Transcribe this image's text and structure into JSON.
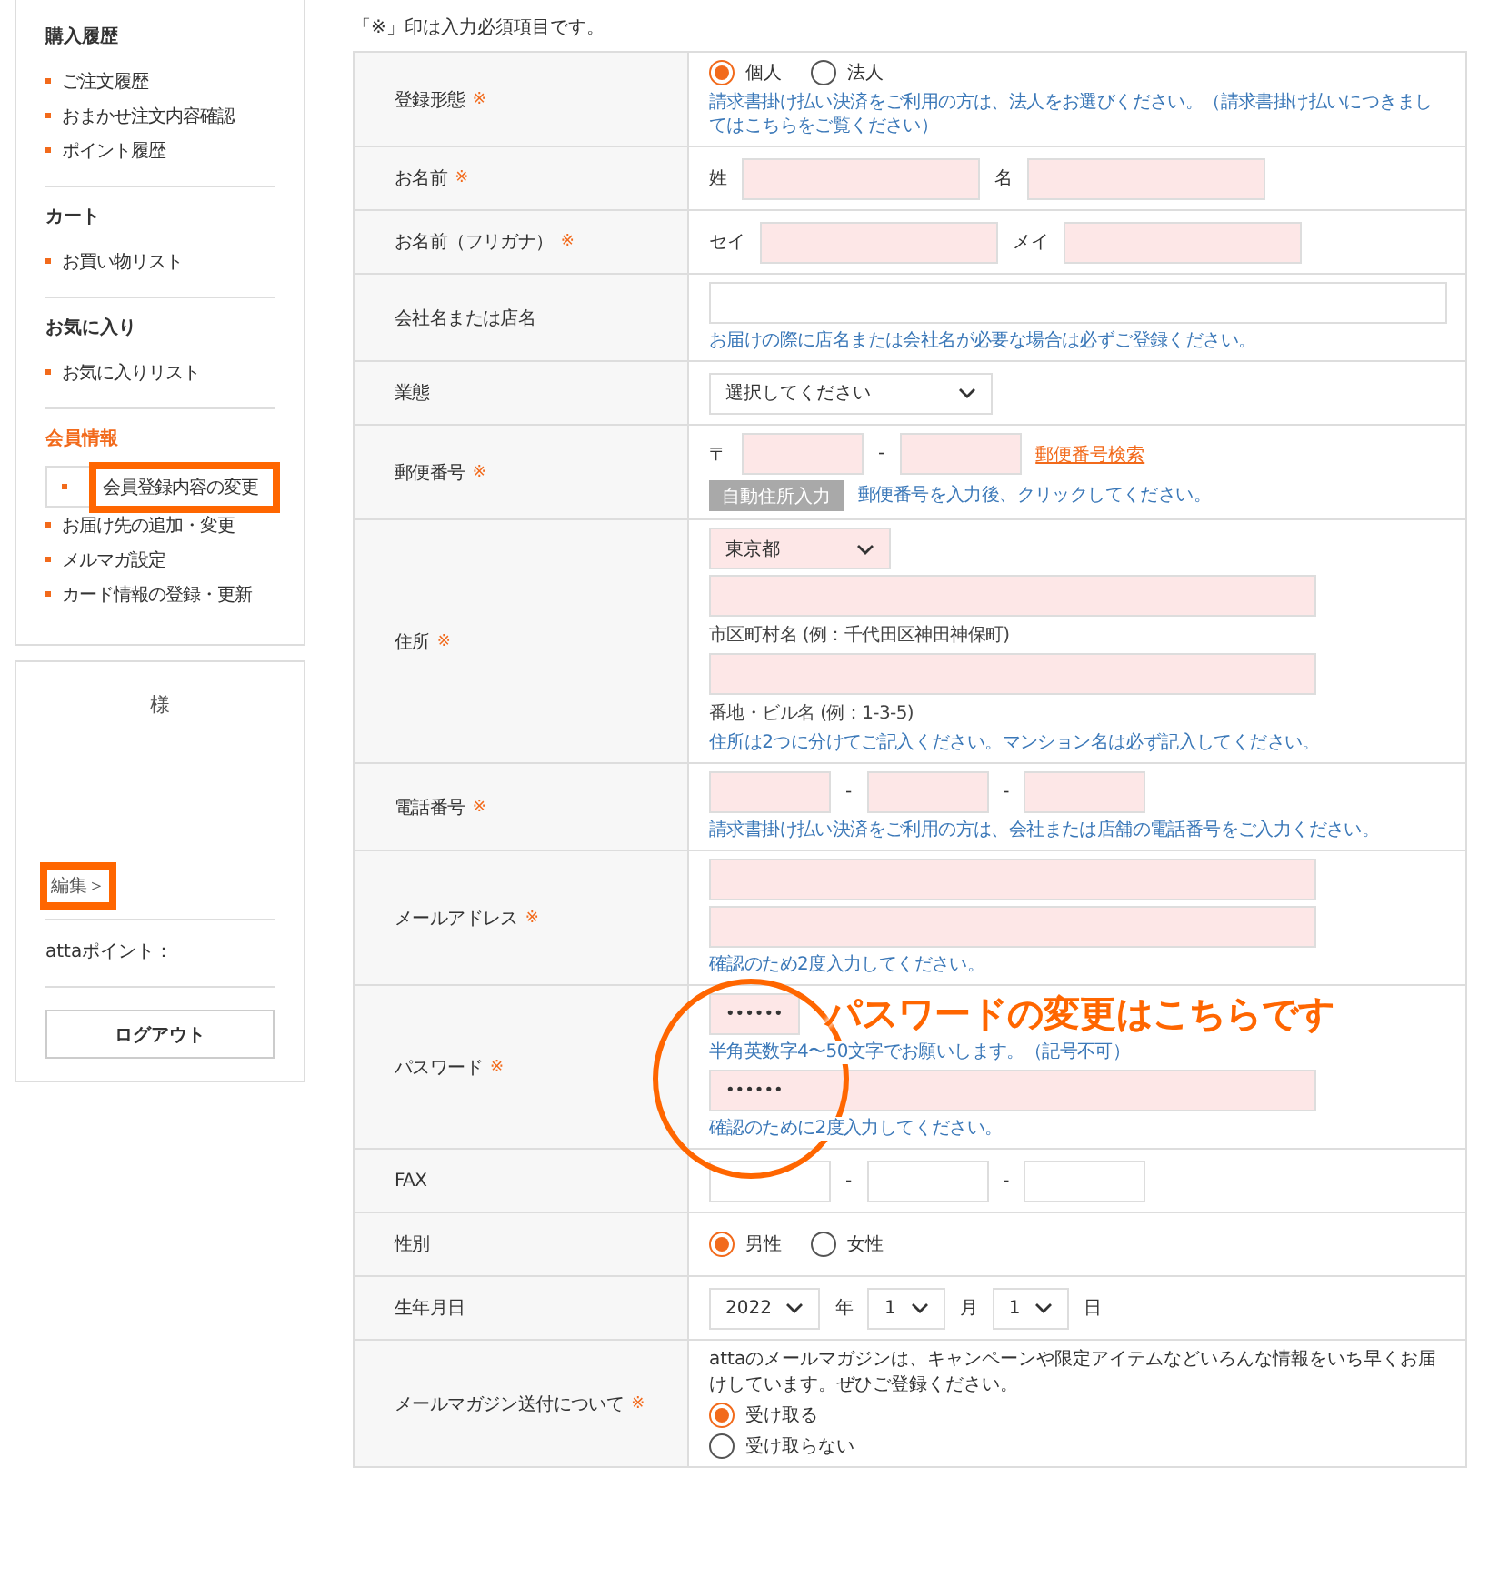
{
  "sidebar": {
    "sections": [
      {
        "title": "購入履歴",
        "active": false,
        "items": [
          {
            "label": "ご注文履歴",
            "selected": false
          },
          {
            "label": "おまかせ注文内容確認",
            "selected": false
          },
          {
            "label": "ポイント履歴",
            "selected": false
          }
        ]
      },
      {
        "title": "カート",
        "active": false,
        "items": [
          {
            "label": "お買い物リスト",
            "selected": false
          }
        ]
      },
      {
        "title": "お気に入り",
        "active": false,
        "items": [
          {
            "label": "お気に入りリスト",
            "selected": false
          }
        ]
      },
      {
        "title": "会員情報",
        "active": true,
        "items": [
          {
            "label": "会員登録内容の変更",
            "selected": true
          },
          {
            "label": "お届け先の追加・変更",
            "selected": false
          },
          {
            "label": "メルマガ設定",
            "selected": false
          },
          {
            "label": "カード情報の登録・更新",
            "selected": false
          }
        ]
      }
    ]
  },
  "member_card": {
    "honorific": "様",
    "edit_link": {
      "label": "編集＞",
      "highlighted": true
    },
    "points_label": "attaポイント：",
    "logout_button": "ログアウト"
  },
  "required_note": "「※」印は入力必須項目です。",
  "form": {
    "rows": [
      {
        "label": "登録形態",
        "mark": "※",
        "lines": [
          [
            {
              "kind": "radio",
              "label": "個人",
              "selected": true
            },
            {
              "kind": "radio",
              "label": "法人",
              "selected": false
            }
          ],
          [
            {
              "kind": "note",
              "text": "請求書掛け払い決済をご利用の方は、法人をお選びください。（請求書掛け払いにつきましてはこちらをご覧ください）"
            }
          ]
        ]
      },
      {
        "label": "お名前",
        "mark": "※",
        "lines": [
          [
            {
              "kind": "label",
              "text": "姓"
            },
            {
              "kind": "input",
              "required": true
            },
            {
              "kind": "label",
              "text": "名"
            },
            {
              "kind": "input",
              "required": true
            }
          ]
        ]
      },
      {
        "label": "お名前（フリガナ）",
        "mark": "※",
        "lines": [
          [
            {
              "kind": "label",
              "text": "セイ"
            },
            {
              "kind": "input",
              "required": true
            },
            {
              "kind": "label",
              "text": "メイ"
            },
            {
              "kind": "input",
              "required": true
            }
          ]
        ]
      },
      {
        "label": "会社名または店名",
        "lines": [
          [
            {
              "kind": "input",
              "required": false
            }
          ],
          [
            {
              "kind": "note",
              "text": "お届けの際に店名または会社名が必要な場合は必ずご登録ください。"
            }
          ]
        ]
      },
      {
        "label": "業態",
        "lines": [
          [
            {
              "kind": "select",
              "required": false,
              "value": "選択してください"
            }
          ]
        ]
      },
      {
        "label": "郵便番号",
        "mark": "※",
        "lines": [
          [
            {
              "kind": "label",
              "text": "〒"
            },
            {
              "kind": "input",
              "required": true
            },
            {
              "kind": "label",
              "text": "-"
            },
            {
              "kind": "input",
              "required": true
            },
            {
              "kind": "link",
              "text": "郵便番号検索"
            }
          ],
          [
            {
              "kind": "button",
              "text": "自動住所入力",
              "disabled": true
            },
            {
              "kind": "note",
              "text": "郵便番号を入力後、クリックしてください。"
            }
          ]
        ]
      },
      {
        "label": "住所",
        "mark": "※",
        "lines": [
          [
            {
              "kind": "select",
              "required": true,
              "value": "東京都"
            }
          ],
          [
            {
              "kind": "input",
              "required": true
            }
          ],
          [
            {
              "kind": "caption",
              "text": "市区町村名 (例：千代田区神田神保町)"
            }
          ],
          [
            {
              "kind": "input",
              "required": true
            }
          ],
          [
            {
              "kind": "caption",
              "text": "番地・ビル名 (例：1-3-5)"
            }
          ],
          [
            {
              "kind": "note",
              "text": "住所は2つに分けてご記入ください。マンション名は必ず記入してください。"
            }
          ]
        ]
      },
      {
        "label": "電話番号",
        "mark": "※",
        "lines": [
          [
            {
              "kind": "input",
              "required": true
            },
            {
              "kind": "label",
              "text": "-"
            },
            {
              "kind": "input",
              "required": true
            },
            {
              "kind": "label",
              "text": "-"
            },
            {
              "kind": "input",
              "required": true
            }
          ],
          [
            {
              "kind": "note",
              "text": "請求書掛け払い決済をご利用の方は、会社または店舗の電話番号をご入力ください。"
            }
          ]
        ]
      },
      {
        "label": "メールアドレス",
        "mark": "※",
        "lines": [
          [
            {
              "kind": "input",
              "required": true
            }
          ],
          [
            {
              "kind": "input",
              "required": true
            }
          ],
          [
            {
              "kind": "note",
              "text": "確認のため2度入力してください。"
            }
          ]
        ]
      },
      {
        "label": "パスワード",
        "mark": "※",
        "circled": true,
        "callout": "パスワードの変更はこちらです",
        "lines": [
          [
            {
              "kind": "input",
              "required": true,
              "value": "••••••"
            }
          ],
          [
            {
              "kind": "note",
              "text": "半角英数字4〜50文字でお願いします。（記号不可）"
            }
          ],
          [
            {
              "kind": "input",
              "required": true,
              "value": "••••••"
            }
          ],
          [
            {
              "kind": "note",
              "text": "確認のために2度入力してください。"
            }
          ]
        ]
      },
      {
        "label": "FAX",
        "lines": [
          [
            {
              "kind": "input",
              "required": false
            },
            {
              "kind": "label",
              "text": "-"
            },
            {
              "kind": "input",
              "required": false
            },
            {
              "kind": "label",
              "text": "-"
            },
            {
              "kind": "input",
              "required": false
            }
          ]
        ]
      },
      {
        "label": "性別",
        "lines": [
          [
            {
              "kind": "radio",
              "label": "男性",
              "selected": true
            },
            {
              "kind": "radio",
              "label": "女性",
              "selected": false
            }
          ]
        ]
      },
      {
        "label": "生年月日",
        "lines": [
          [
            {
              "kind": "select",
              "required": false,
              "value": "2022"
            },
            {
              "kind": "label",
              "text": "年"
            },
            {
              "kind": "select",
              "required": false,
              "value": "1"
            },
            {
              "kind": "label",
              "text": "月"
            },
            {
              "kind": "select",
              "required": false,
              "value": "1"
            },
            {
              "kind": "label",
              "text": "日"
            }
          ]
        ]
      },
      {
        "label": "メールマガジン送付について",
        "mark": "※",
        "lines": [
          [
            {
              "kind": "text",
              "text": "attaのメールマガジンは、キャンペーンや限定アイテムなどいろんな情報をいち早くお届けしています。ぜひご登録ください。"
            }
          ],
          [
            {
              "kind": "radio",
              "label": "受け取る",
              "selected": true
            }
          ],
          [
            {
              "kind": "radio",
              "label": "受け取らない",
              "selected": false
            }
          ]
        ]
      }
    ]
  }
}
